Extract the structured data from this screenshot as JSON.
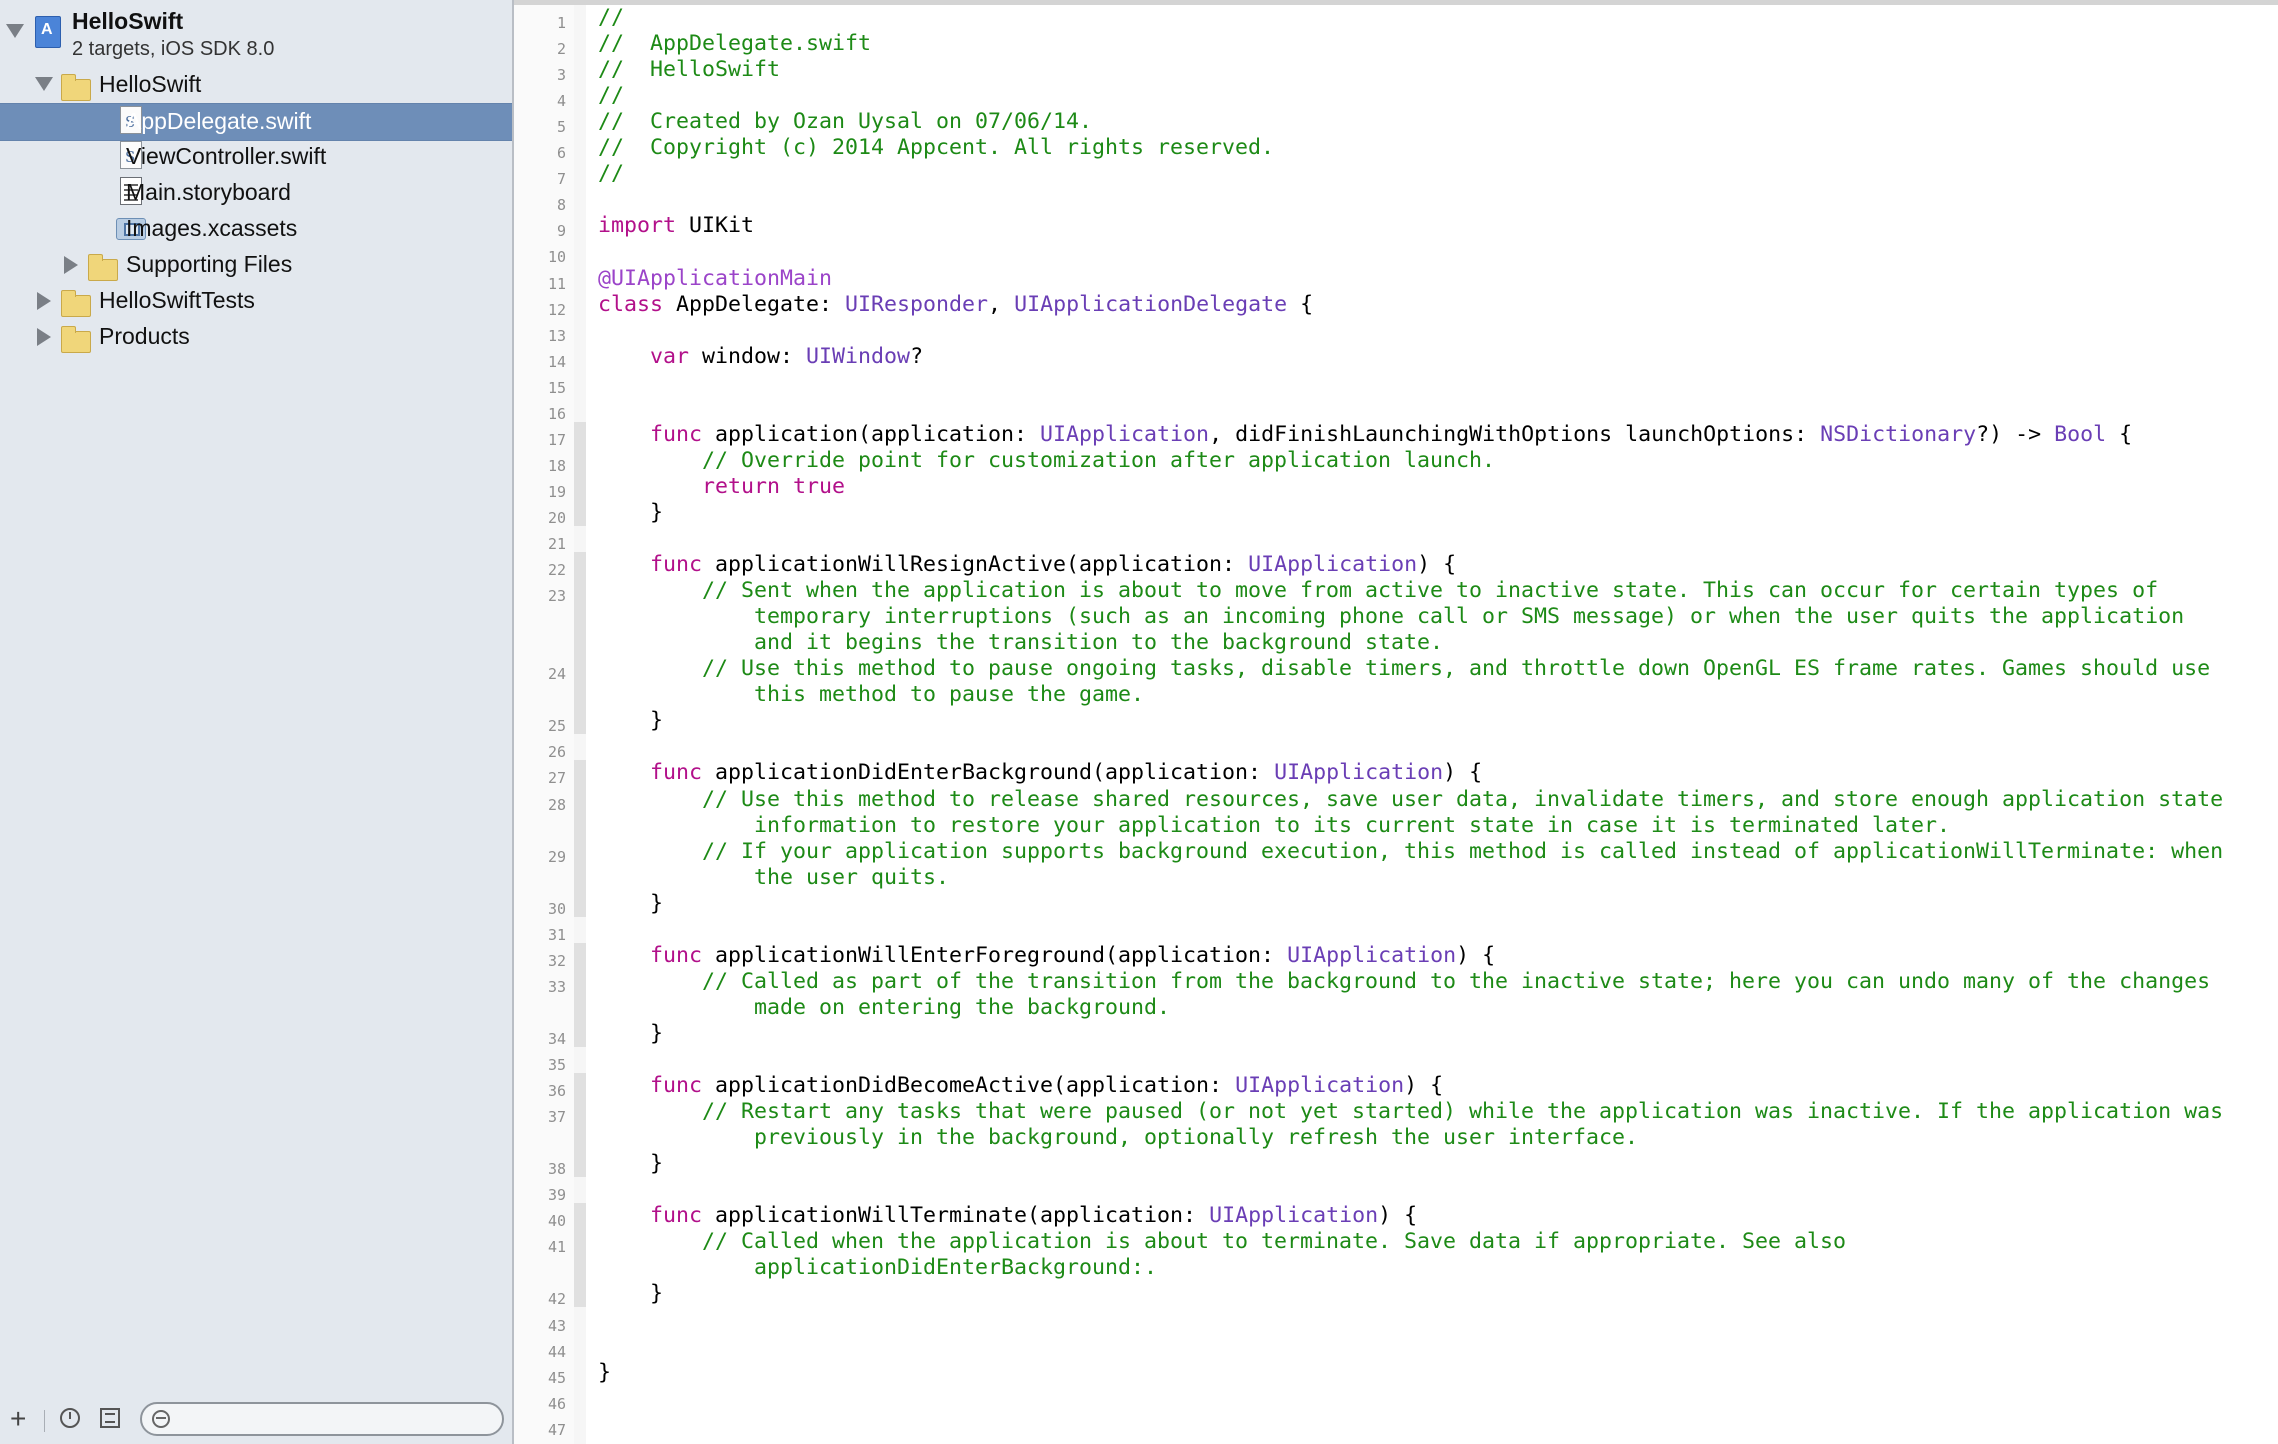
{
  "navigator": {
    "project": {
      "name": "HelloSwift",
      "subtitle": "2 targets, iOS SDK 8.0"
    },
    "items": [
      {
        "label": "HelloSwift",
        "icon": "folder-icon",
        "disclosure": "open",
        "depth": 1,
        "selected": false
      },
      {
        "label": "AppDelegate.swift",
        "icon": "swift-file-icon",
        "disclosure": "none",
        "depth": 2,
        "selected": true
      },
      {
        "label": "ViewController.swift",
        "icon": "swift-file-icon",
        "disclosure": "none",
        "depth": 2,
        "selected": false
      },
      {
        "label": "Main.storyboard",
        "icon": "storyboard-icon",
        "disclosure": "none",
        "depth": 2,
        "selected": false
      },
      {
        "label": "Images.xcassets",
        "icon": "asset-catalog-icon",
        "disclosure": "none",
        "depth": 2,
        "selected": false
      },
      {
        "label": "Supporting Files",
        "icon": "folder-icon",
        "disclosure": "closed",
        "depth": 2,
        "selected": false
      },
      {
        "label": "HelloSwiftTests",
        "icon": "folder-icon",
        "disclosure": "closed",
        "depth": 1,
        "selected": false
      },
      {
        "label": "Products",
        "icon": "folder-icon",
        "disclosure": "closed",
        "depth": 1,
        "selected": false
      }
    ],
    "bottom_bar": {
      "add_label": "+",
      "filter_placeholder": ""
    }
  },
  "editor": {
    "colors": {
      "comment": "#1d8a16",
      "keyword": "#b2108a",
      "type": "#6a3eb5",
      "attribute": "#9b44c9",
      "plain": "#000000"
    },
    "lines": [
      {
        "n": 1,
        "rows": [
          [
            [
              "//",
              "cm"
            ]
          ]
        ]
      },
      {
        "n": 2,
        "rows": [
          [
            [
              "//  AppDelegate.swift",
              "cm"
            ]
          ]
        ]
      },
      {
        "n": 3,
        "rows": [
          [
            [
              "//  HelloSwift",
              "cm"
            ]
          ]
        ]
      },
      {
        "n": 4,
        "rows": [
          [
            [
              "//",
              "cm"
            ]
          ]
        ]
      },
      {
        "n": 5,
        "rows": [
          [
            [
              "//  Created by Ozan Uysal on 07/06/14.",
              "cm"
            ]
          ]
        ]
      },
      {
        "n": 6,
        "rows": [
          [
            [
              "//  Copyright (c) 2014 Appcent. All rights reserved.",
              "cm"
            ]
          ]
        ]
      },
      {
        "n": 7,
        "rows": [
          [
            [
              "//",
              "cm"
            ]
          ]
        ]
      },
      {
        "n": 8,
        "rows": [
          []
        ]
      },
      {
        "n": 9,
        "rows": [
          [
            [
              "import",
              "kw"
            ],
            [
              " UIKit",
              ""
            ]
          ]
        ]
      },
      {
        "n": 10,
        "rows": [
          []
        ]
      },
      {
        "n": 11,
        "rows": [
          [
            [
              "@UIApplicationMain",
              "at"
            ]
          ]
        ]
      },
      {
        "n": 12,
        "rows": [
          [
            [
              "class",
              "kw"
            ],
            [
              " AppDelegate: ",
              ""
            ],
            [
              "UIResponder",
              "ty"
            ],
            [
              ", ",
              ""
            ],
            [
              "UIApplicationDelegate",
              "ty"
            ],
            [
              " {",
              ""
            ]
          ]
        ]
      },
      {
        "n": 13,
        "rows": [
          []
        ]
      },
      {
        "n": 14,
        "rows": [
          [
            [
              "    ",
              ""
            ],
            [
              "var",
              "kw"
            ],
            [
              " window: ",
              ""
            ],
            [
              "UIWindow",
              "ty"
            ],
            [
              "?",
              ""
            ]
          ]
        ]
      },
      {
        "n": 15,
        "rows": [
          []
        ]
      },
      {
        "n": 16,
        "rows": [
          []
        ]
      },
      {
        "n": 17,
        "rows": [
          [
            [
              "    ",
              ""
            ],
            [
              "func",
              "kw"
            ],
            [
              " application(application: ",
              ""
            ],
            [
              "UIApplication",
              "ty"
            ],
            [
              ", didFinishLaunchingWithOptions launchOptions: ",
              ""
            ],
            [
              "NSDictionary",
              "ty"
            ],
            [
              "?) -> ",
              ""
            ],
            [
              "Bool",
              "ty"
            ],
            [
              " {",
              ""
            ]
          ]
        ]
      },
      {
        "n": 18,
        "rows": [
          [
            [
              "        // Override point for customization after application launch.",
              "cm"
            ]
          ]
        ]
      },
      {
        "n": 19,
        "rows": [
          [
            [
              "        ",
              ""
            ],
            [
              "return",
              "kw"
            ],
            [
              " ",
              ""
            ],
            [
              "true",
              "kw"
            ]
          ]
        ]
      },
      {
        "n": 20,
        "rows": [
          [
            [
              "    }",
              ""
            ]
          ]
        ]
      },
      {
        "n": 21,
        "rows": [
          []
        ]
      },
      {
        "n": 22,
        "rows": [
          [
            [
              "    ",
              ""
            ],
            [
              "func",
              "kw"
            ],
            [
              " applicationWillResignActive(application: ",
              ""
            ],
            [
              "UIApplication",
              "ty"
            ],
            [
              ") {",
              ""
            ]
          ]
        ]
      },
      {
        "n": 23,
        "rows": [
          [
            [
              "        // Sent when the application is about to move from active to inactive state. This can occur for certain types of",
              "cm"
            ]
          ],
          [
            [
              "            temporary interruptions (such as an incoming phone call or SMS message) or when the user quits the application",
              "cm"
            ]
          ],
          [
            [
              "            and it begins the transition to the background state.",
              "cm"
            ]
          ]
        ]
      },
      {
        "n": 24,
        "rows": [
          [
            [
              "        // Use this method to pause ongoing tasks, disable timers, and throttle down OpenGL ES frame rates. Games should use",
              "cm"
            ]
          ],
          [
            [
              "            this method to pause the game.",
              "cm"
            ]
          ]
        ]
      },
      {
        "n": 25,
        "rows": [
          [
            [
              "    }",
              ""
            ]
          ]
        ]
      },
      {
        "n": 26,
        "rows": [
          []
        ]
      },
      {
        "n": 27,
        "rows": [
          [
            [
              "    ",
              ""
            ],
            [
              "func",
              "kw"
            ],
            [
              " applicationDidEnterBackground(application: ",
              ""
            ],
            [
              "UIApplication",
              "ty"
            ],
            [
              ") {",
              ""
            ]
          ]
        ]
      },
      {
        "n": 28,
        "rows": [
          [
            [
              "        // Use this method to release shared resources, save user data, invalidate timers, and store enough application state",
              "cm"
            ]
          ],
          [
            [
              "            information to restore your application to its current state in case it is terminated later.",
              "cm"
            ]
          ]
        ]
      },
      {
        "n": 29,
        "rows": [
          [
            [
              "        // If your application supports background execution, this method is called instead of applicationWillTerminate: when",
              "cm"
            ]
          ],
          [
            [
              "            the user quits.",
              "cm"
            ]
          ]
        ]
      },
      {
        "n": 30,
        "rows": [
          [
            [
              "    }",
              ""
            ]
          ]
        ]
      },
      {
        "n": 31,
        "rows": [
          []
        ]
      },
      {
        "n": 32,
        "rows": [
          [
            [
              "    ",
              ""
            ],
            [
              "func",
              "kw"
            ],
            [
              " applicationWillEnterForeground(application: ",
              ""
            ],
            [
              "UIApplication",
              "ty"
            ],
            [
              ") {",
              ""
            ]
          ]
        ]
      },
      {
        "n": 33,
        "rows": [
          [
            [
              "        // Called as part of the transition from the background to the inactive state; here you can undo many of the changes",
              "cm"
            ]
          ],
          [
            [
              "            made on entering the background.",
              "cm"
            ]
          ]
        ]
      },
      {
        "n": 34,
        "rows": [
          [
            [
              "    }",
              ""
            ]
          ]
        ]
      },
      {
        "n": 35,
        "rows": [
          []
        ]
      },
      {
        "n": 36,
        "rows": [
          [
            [
              "    ",
              ""
            ],
            [
              "func",
              "kw"
            ],
            [
              " applicationDidBecomeActive(application: ",
              ""
            ],
            [
              "UIApplication",
              "ty"
            ],
            [
              ") {",
              ""
            ]
          ]
        ]
      },
      {
        "n": 37,
        "rows": [
          [
            [
              "        // Restart any tasks that were paused (or not yet started) while the application was inactive. If the application was",
              "cm"
            ]
          ],
          [
            [
              "            previously in the background, optionally refresh the user interface.",
              "cm"
            ]
          ]
        ]
      },
      {
        "n": 38,
        "rows": [
          [
            [
              "    }",
              ""
            ]
          ]
        ]
      },
      {
        "n": 39,
        "rows": [
          []
        ]
      },
      {
        "n": 40,
        "rows": [
          [
            [
              "    ",
              ""
            ],
            [
              "func",
              "kw"
            ],
            [
              " applicationWillTerminate(application: ",
              ""
            ],
            [
              "UIApplication",
              "ty"
            ],
            [
              ") {",
              ""
            ]
          ]
        ]
      },
      {
        "n": 41,
        "rows": [
          [
            [
              "        // Called when the application is about to terminate. Save data if appropriate. See also",
              "cm"
            ]
          ],
          [
            [
              "            applicationDidEnterBackground:.",
              "cm"
            ]
          ]
        ]
      },
      {
        "n": 42,
        "rows": [
          [
            [
              "    }",
              ""
            ]
          ]
        ]
      },
      {
        "n": 43,
        "rows": [
          []
        ]
      },
      {
        "n": 44,
        "rows": [
          []
        ]
      },
      {
        "n": 45,
        "rows": [
          [
            [
              "}",
              ""
            ]
          ]
        ]
      },
      {
        "n": 46,
        "rows": [
          []
        ]
      },
      {
        "n": 47,
        "rows": [
          []
        ]
      }
    ]
  }
}
